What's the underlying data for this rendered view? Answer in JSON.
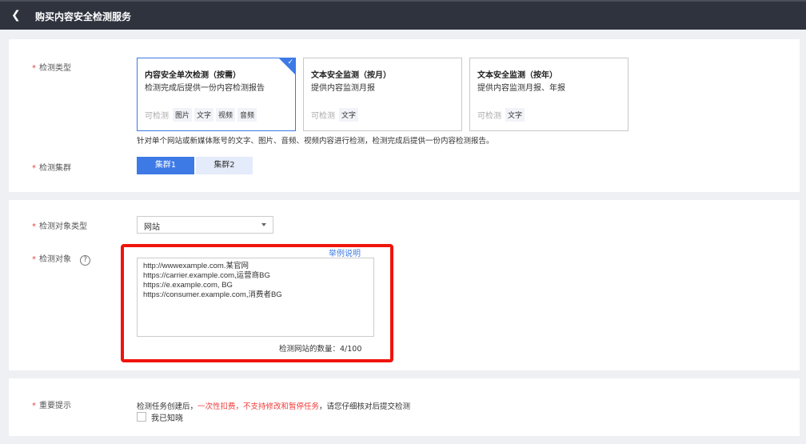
{
  "header": {
    "title": "购买内容安全检测服务"
  },
  "section1": {
    "type_label": "检测类型",
    "cards": [
      {
        "title": "内容安全单次检测（按需）",
        "desc": "检测完成后提供一份内容检测报告",
        "tags_label": "可检测",
        "tags": [
          "图片",
          "文字",
          "视频",
          "音频"
        ],
        "selected": true
      },
      {
        "title": "文本安全监测（按月）",
        "desc": "提供内容监测月报",
        "tags_label": "可检测",
        "tags": [
          "文字"
        ]
      },
      {
        "title": "文本安全监测（按年）",
        "desc": "提供内容监测月报、年报",
        "tags_label": "可检测",
        "tags": [
          "文字"
        ]
      }
    ],
    "description": "针对单个网站或新媒体账号的文字、图片、音频、视频内容进行检测，检测完成后提供一份内容检测报告。",
    "cluster_label": "检测集群",
    "clusters": [
      "集群1",
      "集群2"
    ]
  },
  "section2": {
    "object_type_label": "检测对象类型",
    "object_type_value": "网站",
    "object_label": "检测对象",
    "example_link": "举例说明",
    "objects_text": "http://wwwexample.com.某官网\nhttps://carrier.example.com,运营商BG\nhttps://e.example.com, BG\nhttps://consumer.example.com,消费者BG",
    "count_text": "检测网站的数量：4/100"
  },
  "section3": {
    "label": "重要提示",
    "notice_a": "检测任务创建后，",
    "notice_red": "一次性扣费，不支持修改和暂停任务",
    "notice_b": "，请您仔细核对后提交检测",
    "ack": "我已知晓"
  },
  "colors": {
    "accent": "#3d7ae6",
    "highlight": "#f0140a"
  }
}
